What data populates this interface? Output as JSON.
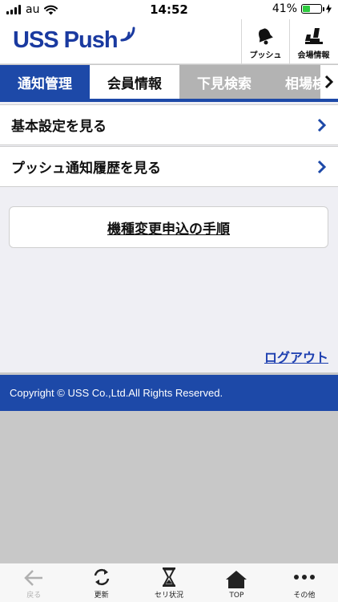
{
  "status_bar": {
    "carrier": "au",
    "time": "14:52",
    "battery_percent": "41%",
    "battery_level": 0.41,
    "battery_color": "#2ecc40"
  },
  "header": {
    "logo_text": "USS Push",
    "push_label": "プッシュ",
    "venue_info_label": "会場情報",
    "brand_color": "#1a3aa0"
  },
  "tabs": [
    {
      "label": "通知管理",
      "active": true
    },
    {
      "label": "会員情報",
      "active": false
    },
    {
      "label": "下見検索",
      "active": false
    },
    {
      "label": "相場検",
      "active": false
    }
  ],
  "main": {
    "items": [
      {
        "label": "基本設定を見る",
        "icon": "chevron-right-icon"
      },
      {
        "label": "プッシュ通知履歴を見る",
        "icon": "chevron-right-icon"
      }
    ],
    "procedure_button": "機種変更申込の手順",
    "logout_link": "ログアウト"
  },
  "footer": {
    "copyright": "Copyright © USS Co.,Ltd.All Rights Reserved."
  },
  "bottom_nav": [
    {
      "label": "戻る",
      "icon": "back-arrow-icon",
      "enabled": false
    },
    {
      "label": "更新",
      "icon": "refresh-icon",
      "enabled": true
    },
    {
      "label": "セリ状況",
      "icon": "hourglass-icon",
      "enabled": true
    },
    {
      "label": "TOP",
      "icon": "home-icon",
      "enabled": true
    },
    {
      "label": "その他",
      "icon": "more-icon",
      "enabled": true
    }
  ]
}
